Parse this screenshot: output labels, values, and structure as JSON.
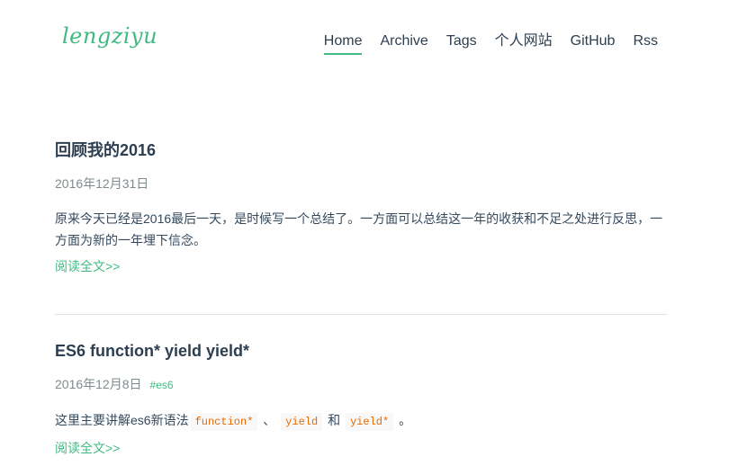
{
  "header": {
    "logo": "lengziyu",
    "nav": [
      {
        "label": "Home",
        "active": true
      },
      {
        "label": "Archive"
      },
      {
        "label": "Tags"
      },
      {
        "label": "个人网站"
      },
      {
        "label": "GitHub"
      },
      {
        "label": "Rss"
      }
    ]
  },
  "posts": [
    {
      "title": "回顾我的2016",
      "date": "2016年12月31日",
      "summary": "原来今天已经是2016最后一天，是时候写一个总结了。一方面可以总结这一年的收获和不足之处进行反思，一方面为新的一年埋下信念。",
      "read_more": "阅读全文>>"
    },
    {
      "title": "ES6 function* yield yield*",
      "date": "2016年12月8日",
      "tag": "#es6",
      "summary_prefix": "这里主要讲解es6新语法",
      "code1": "function*",
      "sep1": "、",
      "code2": "yield",
      "sep2": "和",
      "code3": "yield*",
      "summary_suffix": "。",
      "read_more": "阅读全文>>"
    }
  ],
  "colors": {
    "accent": "#42b983",
    "text": "#2c3e50",
    "meta": "#7f8c8d",
    "code": "#e96900"
  }
}
